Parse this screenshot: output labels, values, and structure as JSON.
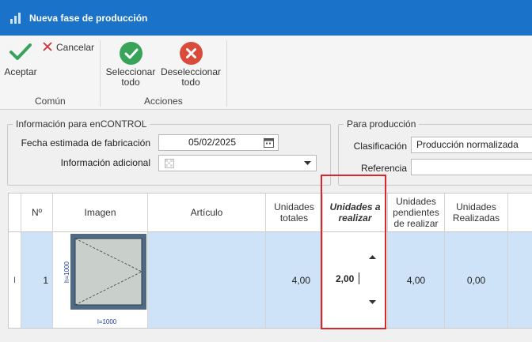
{
  "window": {
    "title": "Nueva fase de producción"
  },
  "ribbon": {
    "accept_label": "Aceptar",
    "cancel_label": "Cancelar",
    "group_common": "Común",
    "select_all_label": "Seleccionar todo",
    "select_all_line1": "Seleccionar",
    "select_all_line2": "todo",
    "deselect_all_line1": "Deseleccionar",
    "deselect_all_line2": "todo",
    "group_actions": "Acciones",
    "colors": {
      "accept": "#3aa35a",
      "select": "#3aa35a",
      "deselect": "#d94b3b",
      "cancel": "#d32f2f"
    }
  },
  "info_encontrol": {
    "legend": "Información para enCONTROL",
    "fecha_label": "Fecha estimada de fabricación",
    "fecha_value": "05/02/2025",
    "info_label": "Información adicional"
  },
  "produccion": {
    "legend": "Para producción",
    "clasificacion_label": "Clasificación",
    "clasificacion_value": "Producción normalizada",
    "referencia_label": "Referencia",
    "referencia_value": ""
  },
  "grid": {
    "headers": {
      "num": "Nº",
      "imagen": "Imagen",
      "articulo": "Artículo",
      "unidades_totales": "Unidades totales",
      "unidades_realizar": "Unidades a realizar",
      "unidades_pendientes": "Unidades pendientes de realizar",
      "unidades_realizadas": "Unidades Realizadas"
    },
    "rows": [
      {
        "num": "1",
        "articulo": "",
        "unidades_totales": "4,00",
        "unidades_realizar": "2,00",
        "unidades_pendientes": "4,00",
        "unidades_realizadas": "0,00",
        "image_dim_height": "h=1000",
        "image_dim_width": "l=1000"
      }
    ]
  }
}
